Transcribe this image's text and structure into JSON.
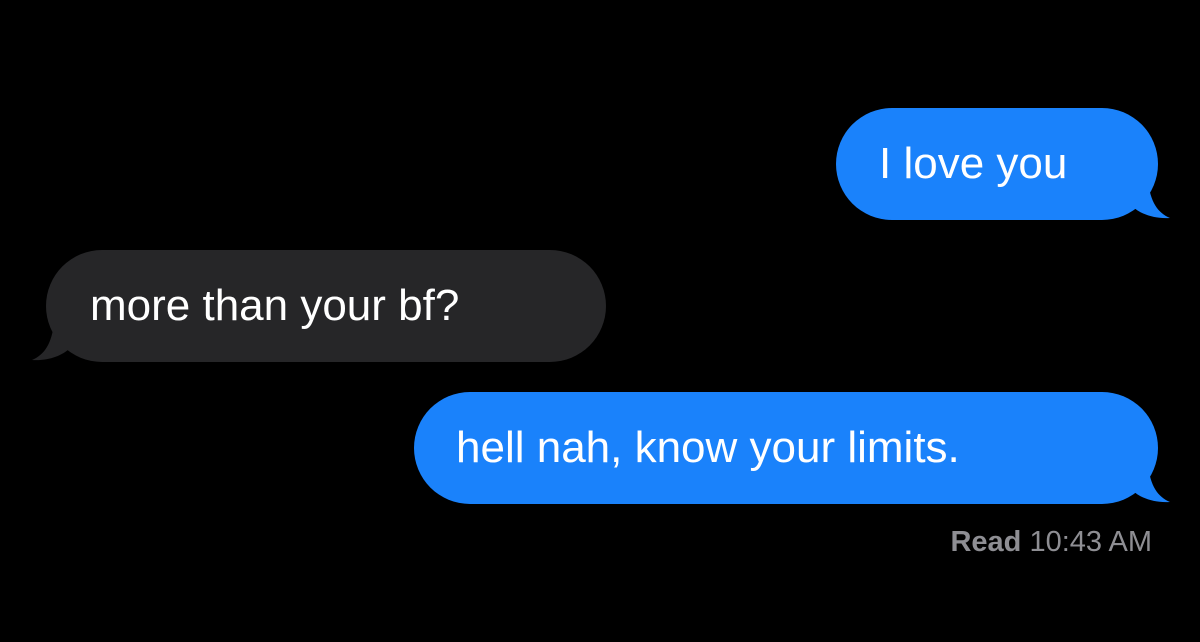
{
  "conversation": {
    "messages": [
      {
        "direction": "sent",
        "text": "I love you"
      },
      {
        "direction": "received",
        "text": "more than your bf?"
      },
      {
        "direction": "sent",
        "text": "hell nah, know your limits."
      }
    ],
    "read_receipt": {
      "label": "Read",
      "time": "10:43 AM"
    }
  },
  "colors": {
    "background": "#000000",
    "sent_bubble": "#1a82fb",
    "received_bubble": "#262628",
    "message_text": "#ffffff",
    "receipt_text": "#8e8e93"
  }
}
